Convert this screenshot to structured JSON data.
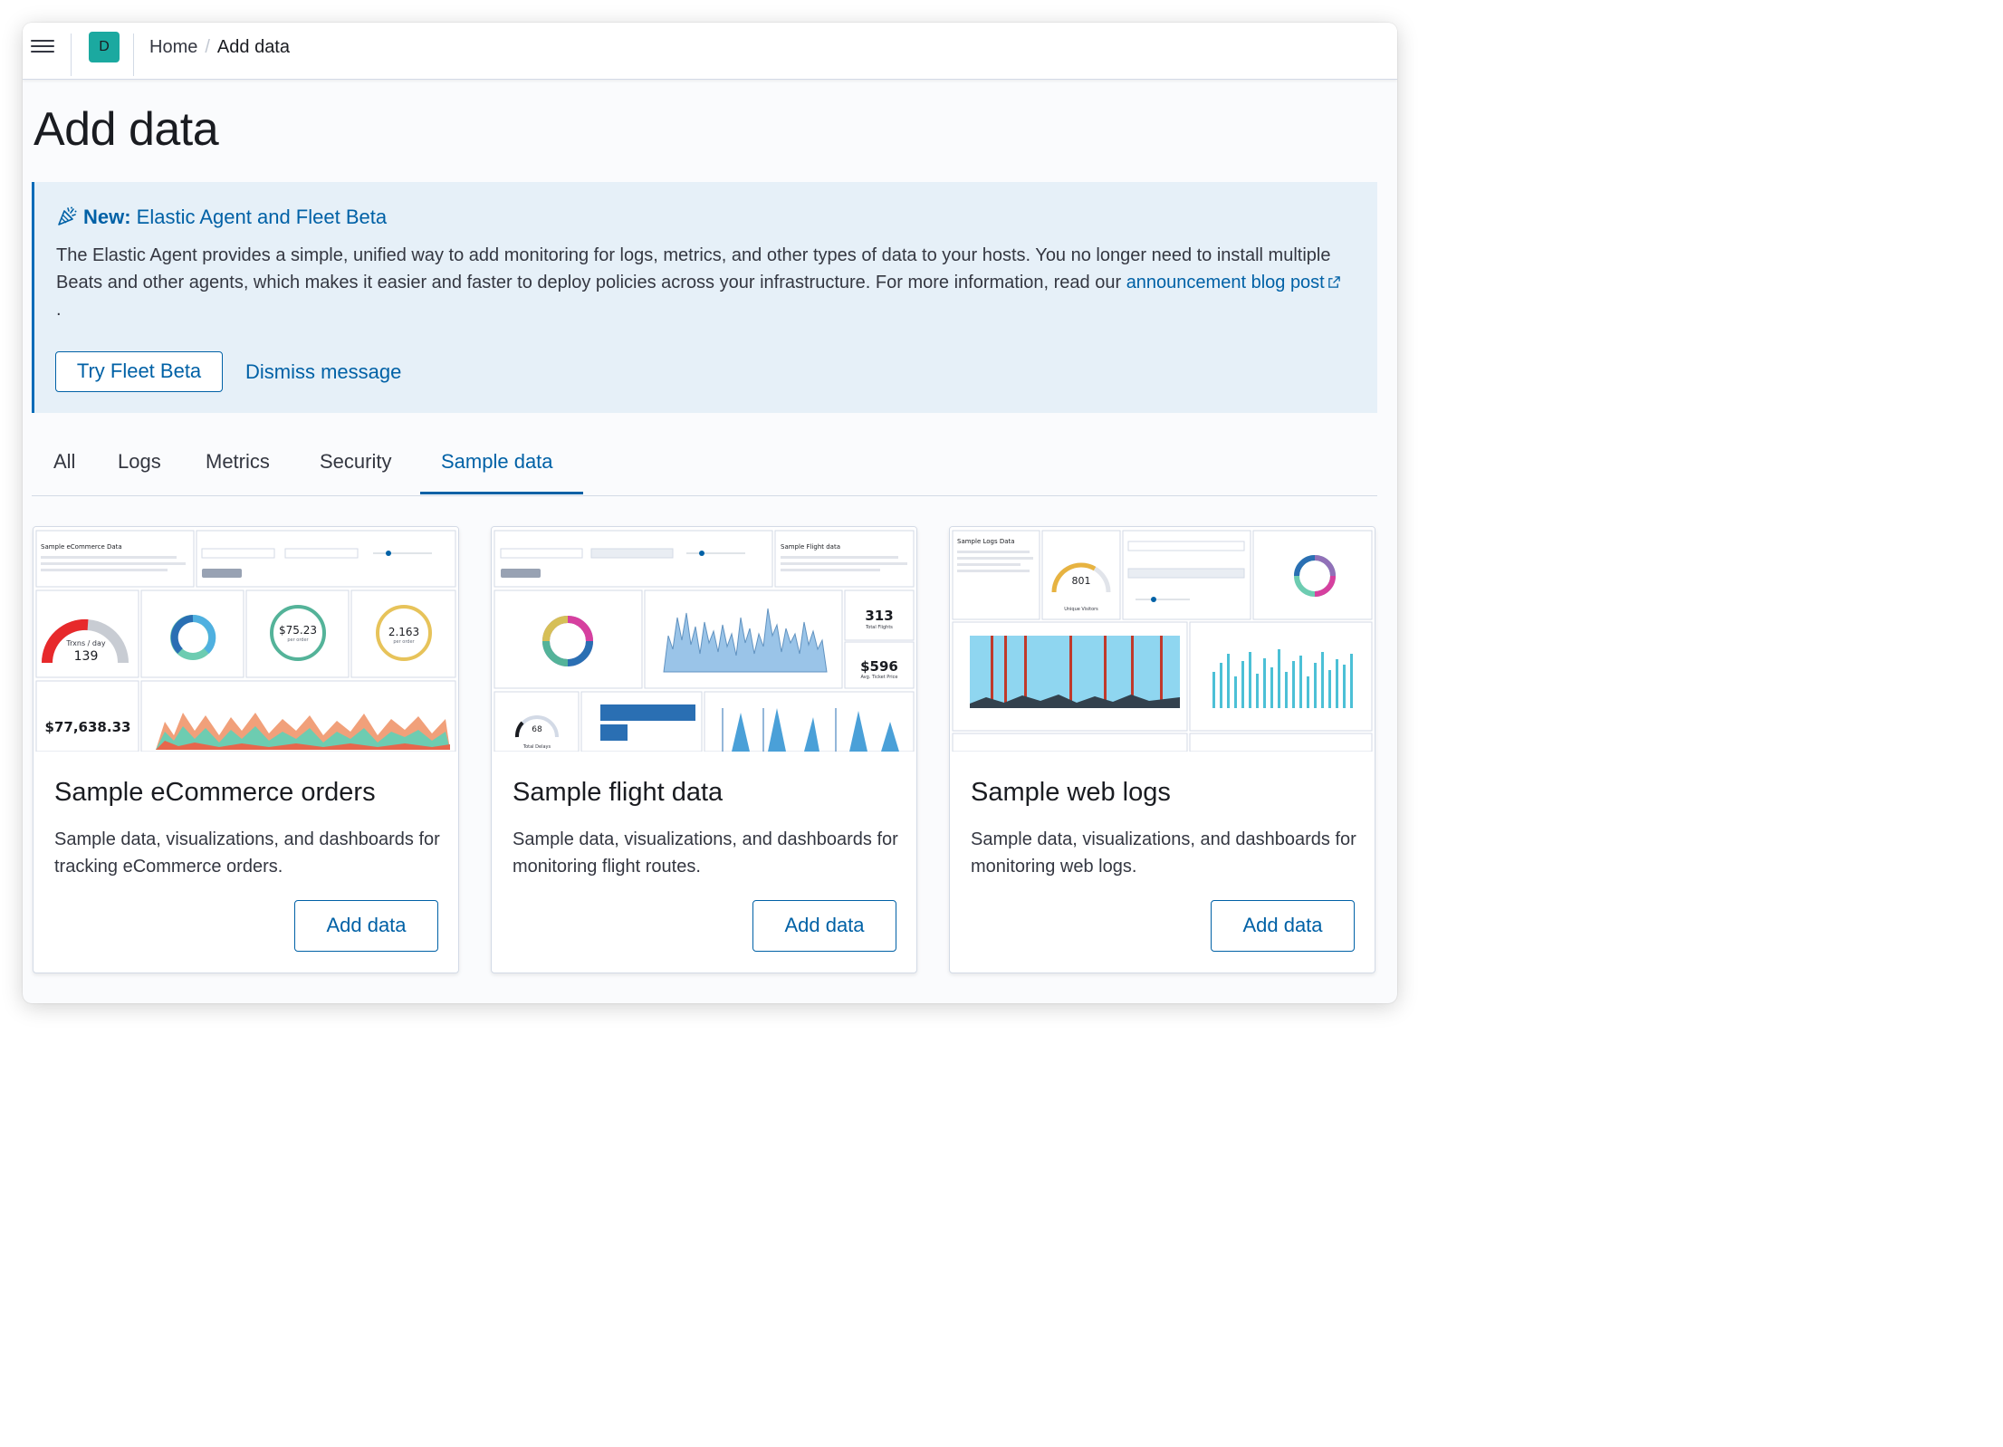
{
  "header": {
    "avatar_letter": "D",
    "breadcrumbs": [
      "Home",
      "Add data"
    ]
  },
  "page": {
    "title": "Add data"
  },
  "callout": {
    "title_strong": "New:",
    "title_rest": " Elastic Agent and Fleet Beta",
    "body": "The Elastic Agent provides a simple, unified way to add monitoring for logs, metrics, and other types of data to your hosts. You no longer need to install multiple Beats and other agents, which makes it easier and faster to deploy policies across your infrastructure. For more information, read our ",
    "link_text": "announcement blog post",
    "after_link": ".",
    "primary_button": "Try Fleet Beta",
    "dismiss_button": "Dismiss message"
  },
  "tabs": [
    "All",
    "Logs",
    "Metrics",
    "Security",
    "Sample data"
  ],
  "active_tab": "Sample data",
  "cards": [
    {
      "title": "Sample eCommerce orders",
      "description": "Sample data, visualizations, and dashboards for tracking eCommerce orders.",
      "button": "Add data",
      "preview": {
        "heading": "Sample eCommerce Data",
        "gauge_label": "Trxns / day",
        "gauge_value": "139",
        "avg_price": "$75.23",
        "avg_price_sub": "per order",
        "avg_items": "2.163",
        "avg_items_sub": "per order",
        "total_revenue": "$77,638.33"
      }
    },
    {
      "title": "Sample flight data",
      "description": "Sample data, visualizations, and dashboards for monitoring flight routes.",
      "button": "Add data",
      "preview": {
        "heading": "Sample Flight data",
        "total_flights": "313",
        "total_flights_label": "Total Flights",
        "avg_price": "$596",
        "avg_price_label": "Avg. Ticket Price",
        "delays": "68",
        "delays_label": "Total Delays"
      }
    },
    {
      "title": "Sample web logs",
      "description": "Sample data, visualizations, and dashboards for monitoring web logs.",
      "button": "Add data",
      "preview": {
        "heading": "Sample Logs Data",
        "visitors": "801",
        "visitors_label": "Unique Visitors"
      }
    }
  ],
  "colors": {
    "accent": "#0061a6",
    "avatar": "#1ba9a0",
    "callout_bg": "#e6f0f8"
  },
  "icons": [
    "menu-icon",
    "party-popper-icon",
    "external-link-icon"
  ]
}
